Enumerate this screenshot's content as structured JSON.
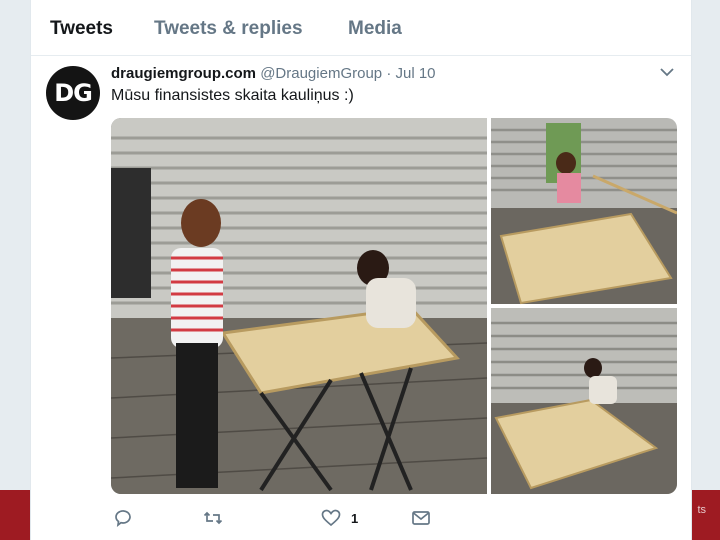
{
  "tabs": [
    {
      "label": "Tweets",
      "active": true
    },
    {
      "label": "Tweets & replies",
      "active": false
    },
    {
      "label": "Media",
      "active": false
    }
  ],
  "tweet": {
    "avatar_text": "DG",
    "display_name": "draugiemgroup.com",
    "handle": "@DraugiemGroup",
    "separator": "·",
    "date": "Jul 10",
    "text": "Mūsu finansistes skaita kauliņus :)",
    "like_count": "1"
  },
  "background": {
    "footer_fragment": "ts"
  },
  "icons": {
    "menu": "chevron-down-icon",
    "reply": "reply-icon",
    "retweet": "retweet-icon",
    "like": "heart-icon",
    "dm": "envelope-icon"
  },
  "colors": {
    "accent_red": "#9e1b22",
    "text_primary": "#14171a",
    "text_secondary": "#657786"
  }
}
